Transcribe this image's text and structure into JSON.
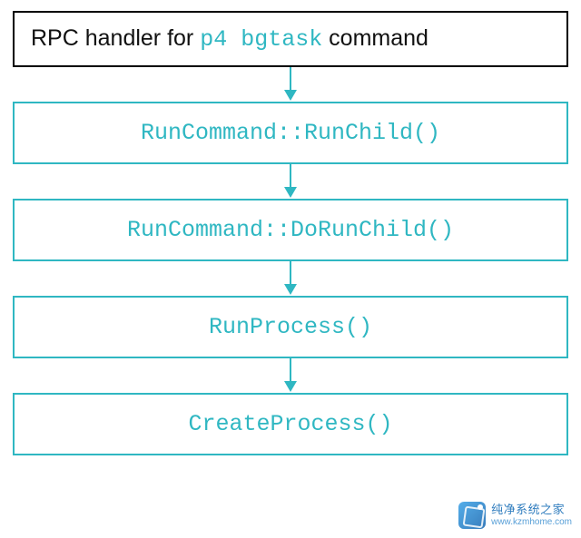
{
  "steps": [
    {
      "type": "header",
      "prefix": "RPC handler for ",
      "code": "p4 bgtask",
      "suffix": " command"
    },
    {
      "type": "call",
      "label": "RunCommand::RunChild()"
    },
    {
      "type": "call",
      "label": "RunCommand::DoRunChild()"
    },
    {
      "type": "call",
      "label": "RunProcess()"
    },
    {
      "type": "call",
      "label": "CreateProcess()"
    }
  ],
  "watermark": {
    "line1": "纯净系统之家",
    "line2": "www.kzmhome.com"
  },
  "colors": {
    "accent": "#2fb7c2",
    "border_dark": "#000000"
  }
}
